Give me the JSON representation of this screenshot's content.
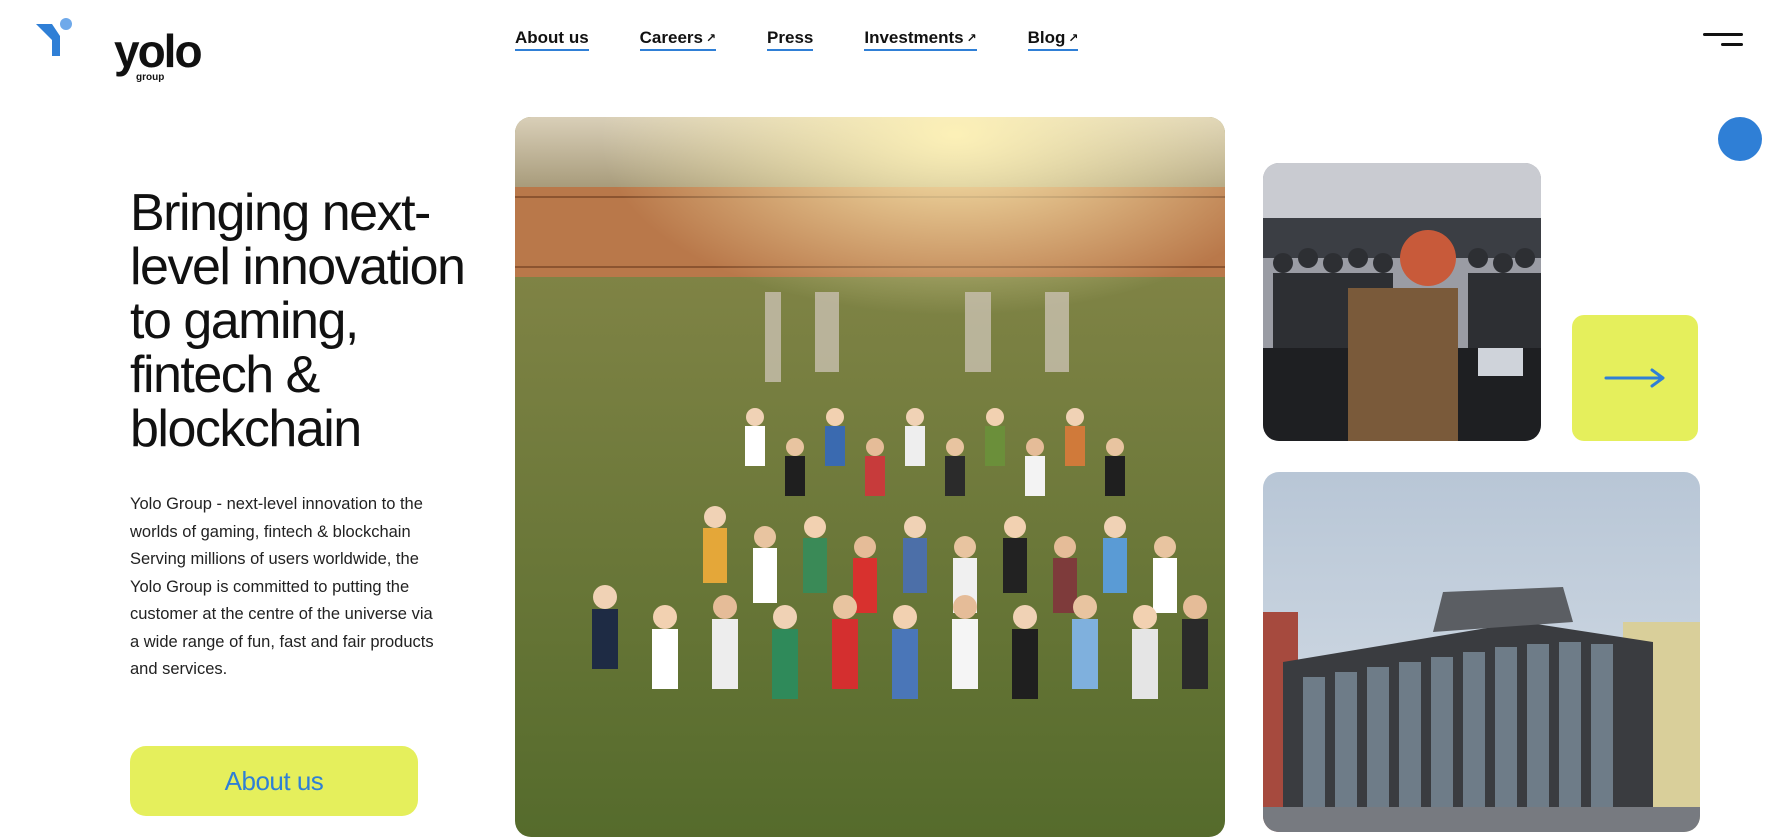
{
  "brand": {
    "name": "yolo",
    "sub": "group"
  },
  "nav": {
    "items": [
      {
        "label": "About us",
        "external": false
      },
      {
        "label": "Careers",
        "external": true
      },
      {
        "label": "Press",
        "external": false
      },
      {
        "label": "Investments",
        "external": true
      },
      {
        "label": "Blog",
        "external": true
      }
    ],
    "external_glyph": "↗"
  },
  "hero": {
    "headline": "Bringing next-level innovation to gaming, fintech & blockchain",
    "description": "Yolo Group - next-level innovation to the worlds of gaming, fintech & blockchain Serving millions of users worldwide, the Yolo Group is committed to putting the customer at the centre of the universe via a wide range of fun, fast and fair products and services.",
    "cta_label": "About us"
  },
  "icons": {
    "menu": "hamburger-menu-icon",
    "arrow": "arrow-right-icon",
    "external": "external-link-icon"
  },
  "colors": {
    "accent_blue": "#2f7fd6",
    "accent_yellow": "#e5ef5c",
    "text": "#111111"
  }
}
